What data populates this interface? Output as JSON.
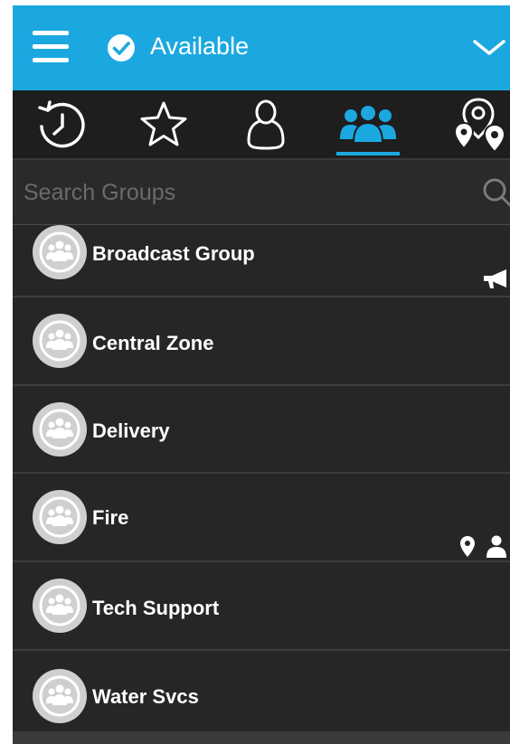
{
  "header": {
    "status_label": "Available",
    "status_icon": "check-circle-icon",
    "menu_icon": "hamburger-menu-icon",
    "expand_icon": "chevron-down-icon",
    "accent_color": "#1ba8e0"
  },
  "tabs": [
    {
      "name": "history",
      "icon": "history-icon",
      "active": false
    },
    {
      "name": "favorites",
      "icon": "star-icon",
      "active": false
    },
    {
      "name": "contacts",
      "icon": "person-icon",
      "active": false
    },
    {
      "name": "groups",
      "icon": "group-icon",
      "active": true
    },
    {
      "name": "map",
      "icon": "map-pins-icon",
      "active": false
    }
  ],
  "search": {
    "placeholder": "Search Groups",
    "value": ""
  },
  "groups": [
    {
      "name": "Broadcast Group",
      "indicator": "megaphone-icon"
    },
    {
      "name": "Central Zone",
      "indicator": ""
    },
    {
      "name": "Delivery",
      "indicator": ""
    },
    {
      "name": "Fire",
      "indicator": "location-person-icons"
    },
    {
      "name": "Tech Support",
      "indicator": ""
    },
    {
      "name": "Water Svcs",
      "indicator": ""
    }
  ]
}
